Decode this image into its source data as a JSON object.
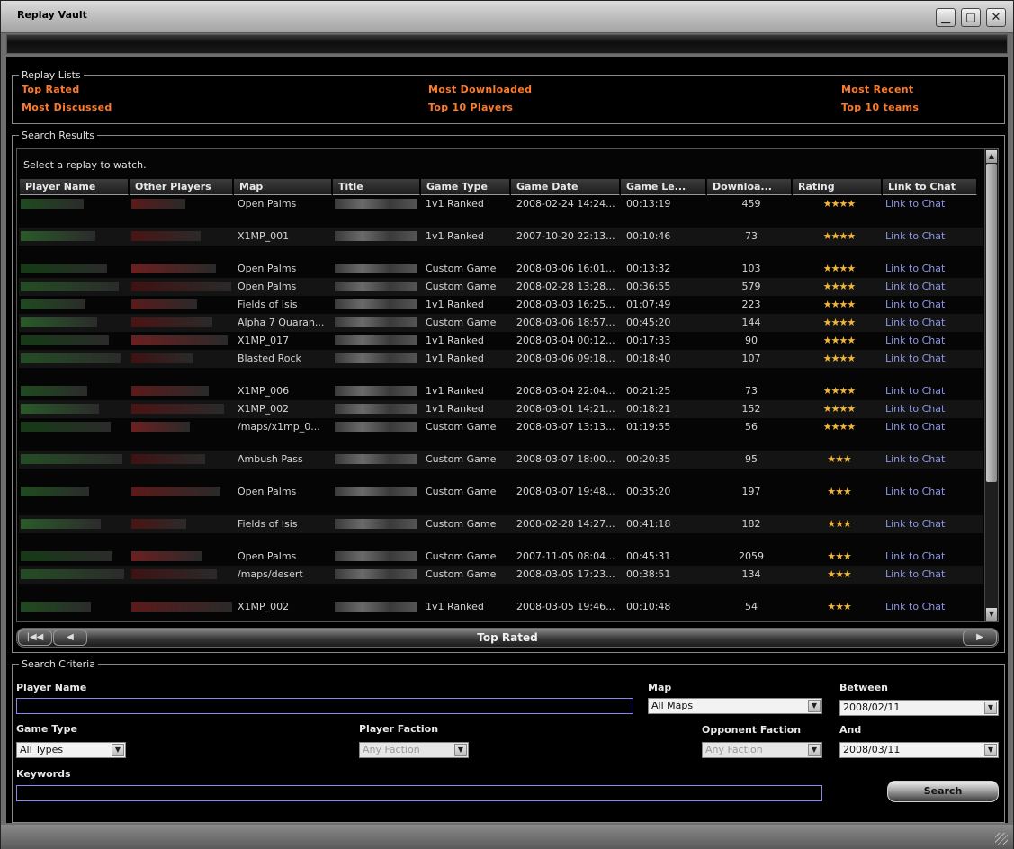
{
  "window": {
    "title": "Replay Vault"
  },
  "replay_lists": {
    "legend": "Replay Lists",
    "links": [
      "Top Rated",
      "Most Downloaded",
      "Most Recent",
      "Most Discussed",
      "Top 10 Players",
      "Top 10 teams"
    ]
  },
  "results": {
    "legend": "Search Results",
    "hint": "Select a replay to watch.",
    "columns": [
      "Player Name",
      "Other Players",
      "Map",
      "Title",
      "Game Type",
      "Game Date",
      "Game Le...",
      "Downloa...",
      "Rating",
      "Link to Chat"
    ],
    "rows": [
      {
        "map": "Open Palms",
        "type": "1v1 Ranked",
        "date": "2008-02-24 14:24...",
        "len": "00:13:19",
        "dl": "459",
        "rating": "★★★★",
        "chat": "Link to Chat"
      },
      {
        "map": "X1MP_001",
        "type": "1v1 Ranked",
        "date": "2007-10-20 22:13...",
        "len": "00:10:46",
        "dl": "73",
        "rating": "★★★★",
        "chat": "Link to Chat"
      },
      {
        "map": "Open Palms",
        "type": "Custom Game",
        "date": "2008-03-06 16:01...",
        "len": "00:13:32",
        "dl": "103",
        "rating": "★★★★",
        "chat": "Link to Chat"
      },
      {
        "map": "Open Palms",
        "type": "Custom Game",
        "date": "2008-02-28 13:28...",
        "len": "00:36:55",
        "dl": "579",
        "rating": "★★★★",
        "chat": "Link to Chat"
      },
      {
        "map": "Fields of Isis",
        "type": "1v1 Ranked",
        "date": "2008-03-03 16:25...",
        "len": "01:07:49",
        "dl": "223",
        "rating": "★★★★",
        "chat": "Link to Chat"
      },
      {
        "map": "Alpha 7 Quaran...",
        "type": "Custom Game",
        "date": "2008-03-06 18:57...",
        "len": "00:45:20",
        "dl": "144",
        "rating": "★★★★",
        "chat": "Link to Chat"
      },
      {
        "map": "X1MP_017",
        "type": "1v1 Ranked",
        "date": "2008-03-04 00:12...",
        "len": "00:17:33",
        "dl": "90",
        "rating": "★★★★",
        "chat": "Link to Chat"
      },
      {
        "map": "Blasted Rock",
        "type": "1v1 Ranked",
        "date": "2008-03-06 09:18...",
        "len": "00:18:40",
        "dl": "107",
        "rating": "★★★★",
        "chat": "Link to Chat"
      },
      {
        "map": "X1MP_006",
        "type": "1v1 Ranked",
        "date": "2008-03-04 22:04...",
        "len": "00:21:25",
        "dl": "73",
        "rating": "★★★★",
        "chat": "Link to Chat"
      },
      {
        "map": "X1MP_002",
        "type": "1v1 Ranked",
        "date": "2008-03-01 14:21...",
        "len": "00:18:21",
        "dl": "152",
        "rating": "★★★★",
        "chat": "Link to Chat"
      },
      {
        "map": "/maps/x1mp_0...",
        "type": "Custom Game",
        "date": "2008-03-07 13:13...",
        "len": "01:19:55",
        "dl": "56",
        "rating": "★★★★",
        "chat": "Link to Chat"
      },
      {
        "map": "Ambush Pass",
        "type": "Custom Game",
        "date": "2008-03-07 18:00...",
        "len": "00:20:35",
        "dl": "95",
        "rating": "★★★",
        "chat": "Link to Chat"
      },
      {
        "map": "Open Palms",
        "type": "Custom Game",
        "date": "2008-03-07 19:48...",
        "len": "00:35:20",
        "dl": "197",
        "rating": "★★★",
        "chat": "Link to Chat"
      },
      {
        "map": "Fields of Isis",
        "type": "Custom Game",
        "date": "2008-02-28 14:27...",
        "len": "00:41:18",
        "dl": "182",
        "rating": "★★★",
        "chat": "Link to Chat"
      },
      {
        "map": "Open Palms",
        "type": "Custom Game",
        "date": "2007-11-05 08:04...",
        "len": "00:45:31",
        "dl": "2059",
        "rating": "★★★",
        "chat": "Link to Chat"
      },
      {
        "map": "/maps/desert",
        "type": "Custom Game",
        "date": "2008-03-05 17:23...",
        "len": "00:38:51",
        "dl": "134",
        "rating": "★★★",
        "chat": "Link to Chat"
      },
      {
        "map": "X1MP_002",
        "type": "1v1 Ranked",
        "date": "2008-03-05 19:46...",
        "len": "00:10:48",
        "dl": "54",
        "rating": "★★★",
        "chat": "Link to Chat"
      }
    ]
  },
  "pager": {
    "label": "Top Rated",
    "first": "|◀◀",
    "prev": "◀",
    "next": "▶"
  },
  "criteria": {
    "legend": "Search Criteria",
    "player_name_label": "Player Name",
    "player_name_value": "",
    "map_label": "Map",
    "map_value": "All Maps",
    "between_label": "Between",
    "between_value": "2008/02/11",
    "game_type_label": "Game Type",
    "game_type_value": "All Types",
    "player_faction_label": "Player Faction",
    "player_faction_value": "Any Faction",
    "opponent_faction_label": "Opponent Faction",
    "opponent_faction_value": "Any Faction",
    "and_label": "And",
    "and_value": "2008/03/11",
    "keywords_label": "Keywords",
    "keywords_value": "",
    "search_button": "Search"
  },
  "colors": {
    "link_orange": "#ff7a2a",
    "chat_link": "#8c96e6",
    "star": "#f5b731"
  }
}
